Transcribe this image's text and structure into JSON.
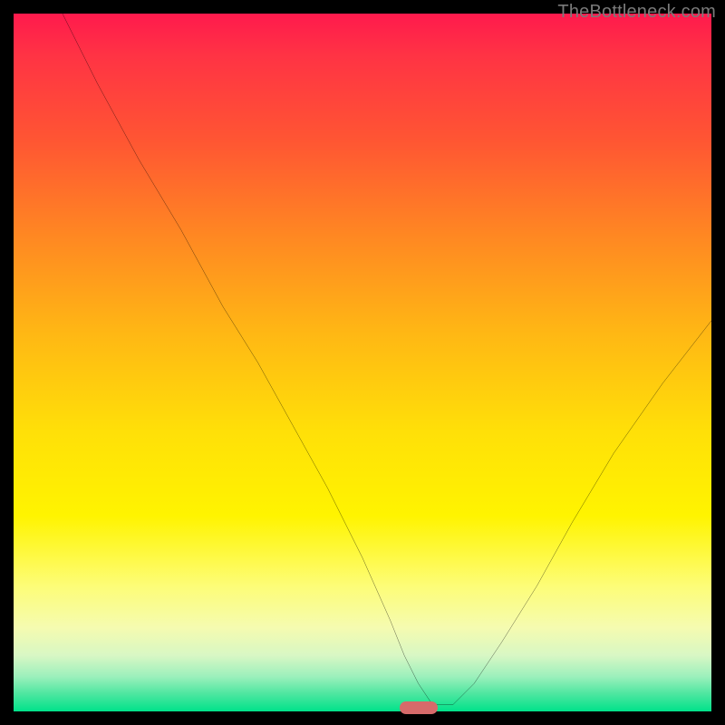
{
  "watermark": "TheBottleneck.com",
  "chart_data": {
    "type": "line",
    "title": "",
    "xlabel": "",
    "ylabel": "",
    "xlim": [
      0,
      100
    ],
    "ylim": [
      0,
      100
    ],
    "series": [
      {
        "name": "curve",
        "x": [
          7,
          12,
          18,
          24,
          30,
          35,
          40,
          45,
          50,
          54,
          56,
          58,
          60,
          63,
          66,
          70,
          75,
          80,
          86,
          93,
          100
        ],
        "y": [
          100,
          90,
          79,
          69,
          58,
          50,
          41,
          32,
          22,
          13,
          8,
          4,
          1,
          1,
          4,
          10,
          18,
          27,
          37,
          47,
          56
        ]
      }
    ],
    "marker": {
      "x": 58,
      "y": 0,
      "shape": "pill",
      "color": "#d66a6a"
    },
    "gradient_stops": [
      {
        "pos": 0,
        "color": "#ff1a4d"
      },
      {
        "pos": 50,
        "color": "#ffd400"
      },
      {
        "pos": 100,
        "color": "#00e28a"
      }
    ]
  }
}
